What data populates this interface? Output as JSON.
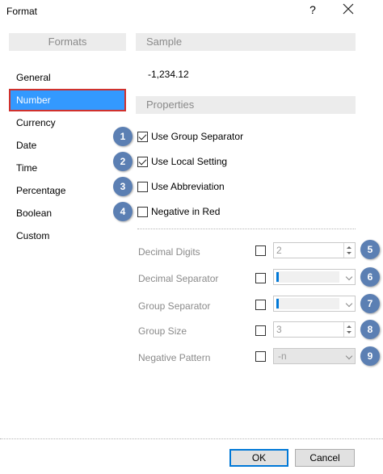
{
  "window": {
    "title": "Format",
    "help_glyph": "?",
    "close_icon": "close-icon"
  },
  "formats": {
    "header": "Formats",
    "items": [
      "General",
      "Number",
      "Currency",
      "Date",
      "Time",
      "Percentage",
      "Boolean",
      "Custom"
    ],
    "selected": "Number"
  },
  "sample": {
    "header": "Sample",
    "value": "-1,234.12"
  },
  "properties": {
    "header": "Properties",
    "options": [
      {
        "badge": "1",
        "label": "Use Group Separator",
        "checked": true
      },
      {
        "badge": "2",
        "label": "Use Local Setting",
        "checked": true
      },
      {
        "badge": "3",
        "label": "Use Abbreviation",
        "checked": false
      },
      {
        "badge": "4",
        "label": "Negative in Red",
        "checked": false
      }
    ],
    "fields": [
      {
        "badge": "5",
        "label": "Decimal Digits",
        "type": "spinner",
        "value": "2",
        "checked": false
      },
      {
        "badge": "6",
        "label": "Decimal Separator",
        "type": "combo",
        "value": "",
        "checked": false
      },
      {
        "badge": "7",
        "label": "Group Separator",
        "type": "combo",
        "value": "",
        "checked": false
      },
      {
        "badge": "8",
        "label": "Group Size",
        "type": "spinner",
        "value": "3",
        "checked": false
      },
      {
        "badge": "9",
        "label": "Negative Pattern",
        "type": "combo",
        "value": "-n",
        "checked": false
      }
    ]
  },
  "buttons": {
    "ok": "OK",
    "cancel": "Cancel"
  },
  "colors": {
    "selection": "#3399ff",
    "selection_border": "#d0312d",
    "badge": "#5b7fb3",
    "header_bg": "#ececec"
  }
}
